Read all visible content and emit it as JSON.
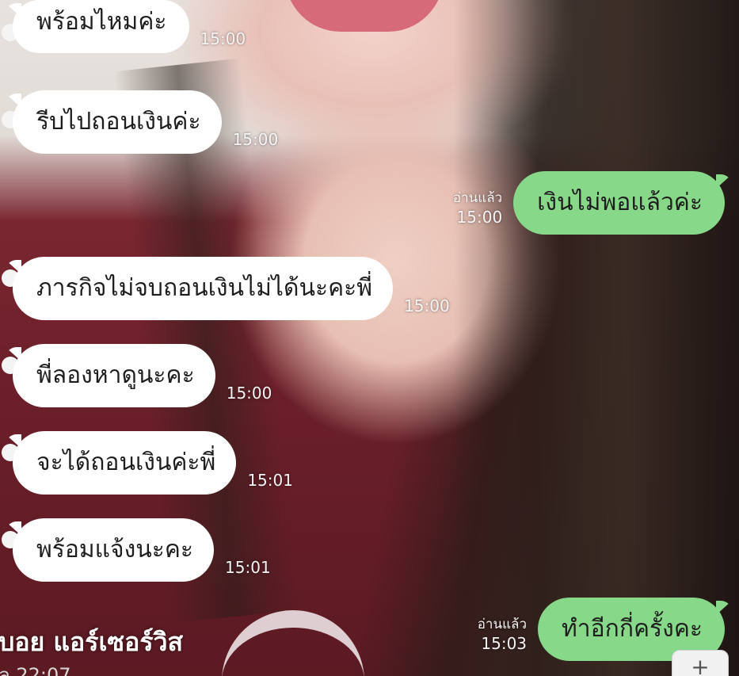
{
  "messages": [
    {
      "id": "m1",
      "side": "in",
      "text": "พร้อมไหมค่ะ",
      "time": "15:00"
    },
    {
      "id": "m2",
      "side": "in",
      "text": "รีบไปถอนเงินค่ะ",
      "time": "15:00"
    },
    {
      "id": "m3",
      "side": "out",
      "text": "เงินไม่พอแล้วค่ะ",
      "time": "15:00",
      "read": "อ่านแล้ว"
    },
    {
      "id": "m4",
      "side": "in",
      "text": "ภารกิจไม่จบถอนเงินไม่ได้นะคะพี่",
      "time": "15:00"
    },
    {
      "id": "m5",
      "side": "in",
      "text": "พี่ลองหาดูนะคะ",
      "time": "15:00"
    },
    {
      "id": "m6",
      "side": "in",
      "text": "จะได้ถอนเงินค่ะพี่",
      "time": "15:01"
    },
    {
      "id": "m7",
      "side": "in",
      "text": "พร้อมแจ้งนะคะ",
      "time": "15:01"
    },
    {
      "id": "m8",
      "side": "out",
      "text": "ทำอีกกี่ครั้งคะ",
      "time": "15:03",
      "read": "อ่านแล้ว"
    }
  ],
  "post": {
    "author": "บอย แอร์เซอร์วิส",
    "time": "ล 22:07"
  },
  "colors": {
    "incoming_bubble": "#ffffff",
    "outgoing_bubble": "#88d88a",
    "meta_text": "#f4f4f4"
  },
  "icons": {
    "corner_button": "plus-icon"
  }
}
